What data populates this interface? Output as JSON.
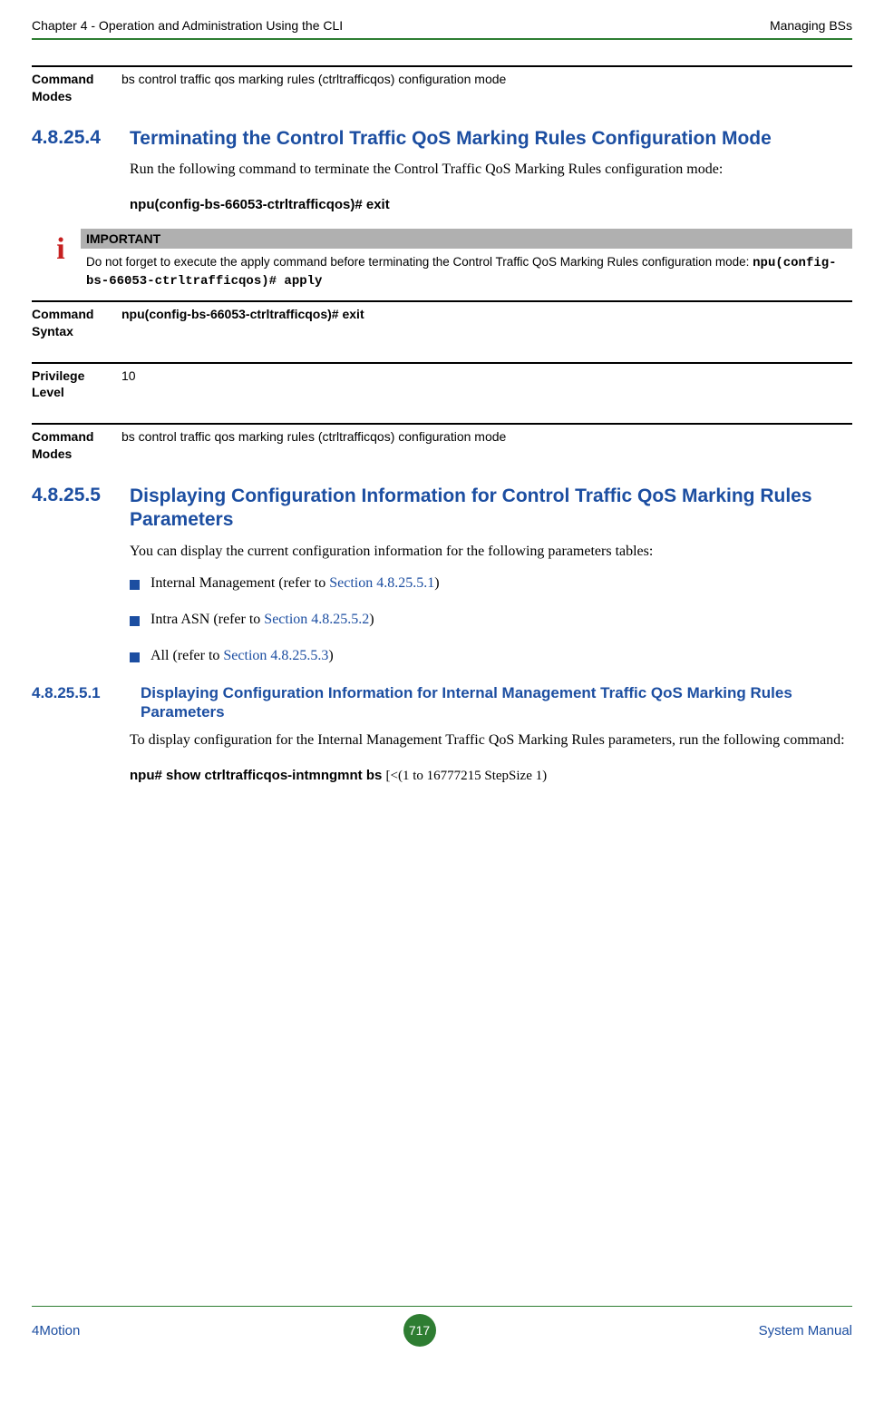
{
  "header": {
    "left": "Chapter 4 - Operation and Administration Using the CLI",
    "right": "Managing BSs"
  },
  "row_command_modes_top": {
    "label": "Command Modes",
    "value": "bs control traffic qos marking rules (ctrltrafficqos) configuration mode"
  },
  "section_4_8_25_4": {
    "num": "4.8.25.4",
    "title_part1": "Terminating the Control ",
    "title_part2": "Traffic QoS Marking Rules Configuration Mode",
    "body1": "Run the following command to terminate the Control Traffic QoS Marking Rules configuration mode:",
    "cmd_prefix": "npu(config-bs-66053-ctrltrafficqos)#",
    "cmd_action": " exit"
  },
  "important": {
    "label": "IMPORTANT",
    "text_prefix": "Do not forget to execute the apply command before terminating the Control Traffic QoS Marking Rules configuration mode: ",
    "text_cmd": "npu(config-bs-66053-ctrltrafficqos)# apply"
  },
  "row_command_syntax": {
    "label": "Command Syntax",
    "value": "npu(config-bs-66053-ctrltrafficqos)# exit"
  },
  "row_privilege": {
    "label": "Privilege Level",
    "value": "10"
  },
  "row_command_modes_bottom": {
    "label": "Command Modes",
    "value": "bs control traffic qos marking rules (ctrltrafficqos) configuration mode"
  },
  "section_4_8_25_5": {
    "num": "4.8.25.5",
    "title": "Displaying Configuration Information for Control Traffic QoS Marking Rules Parameters",
    "body1": "You can display the current configuration information for the following parameters tables:",
    "bullets": [
      {
        "text_pre": "Internal Management (refer to ",
        "link": "Section 4.8.25.5.1",
        "text_post": ")"
      },
      {
        "text_pre": "Intra ASN (refer to ",
        "link": "Section 4.8.25.5.2",
        "text_post": ")"
      },
      {
        "text_pre": "All (refer to ",
        "link": "Section 4.8.25.5.3",
        "text_post": ")"
      }
    ]
  },
  "section_4_8_25_5_1": {
    "num": "4.8.25.5.1",
    "title": "Displaying Configuration Information for Internal Management Traffic QoS Marking Rules Parameters",
    "body1": "To display configuration for the Internal Management Traffic QoS Marking Rules parameters, run the following command:",
    "cmd_bold": "npu# show ctrltrafficqos-intmngmnt bs ",
    "cmd_rest": "[<(1 to 16777215 StepSize 1)"
  },
  "footer": {
    "left": "4Motion",
    "page": "717",
    "right": "System Manual"
  }
}
